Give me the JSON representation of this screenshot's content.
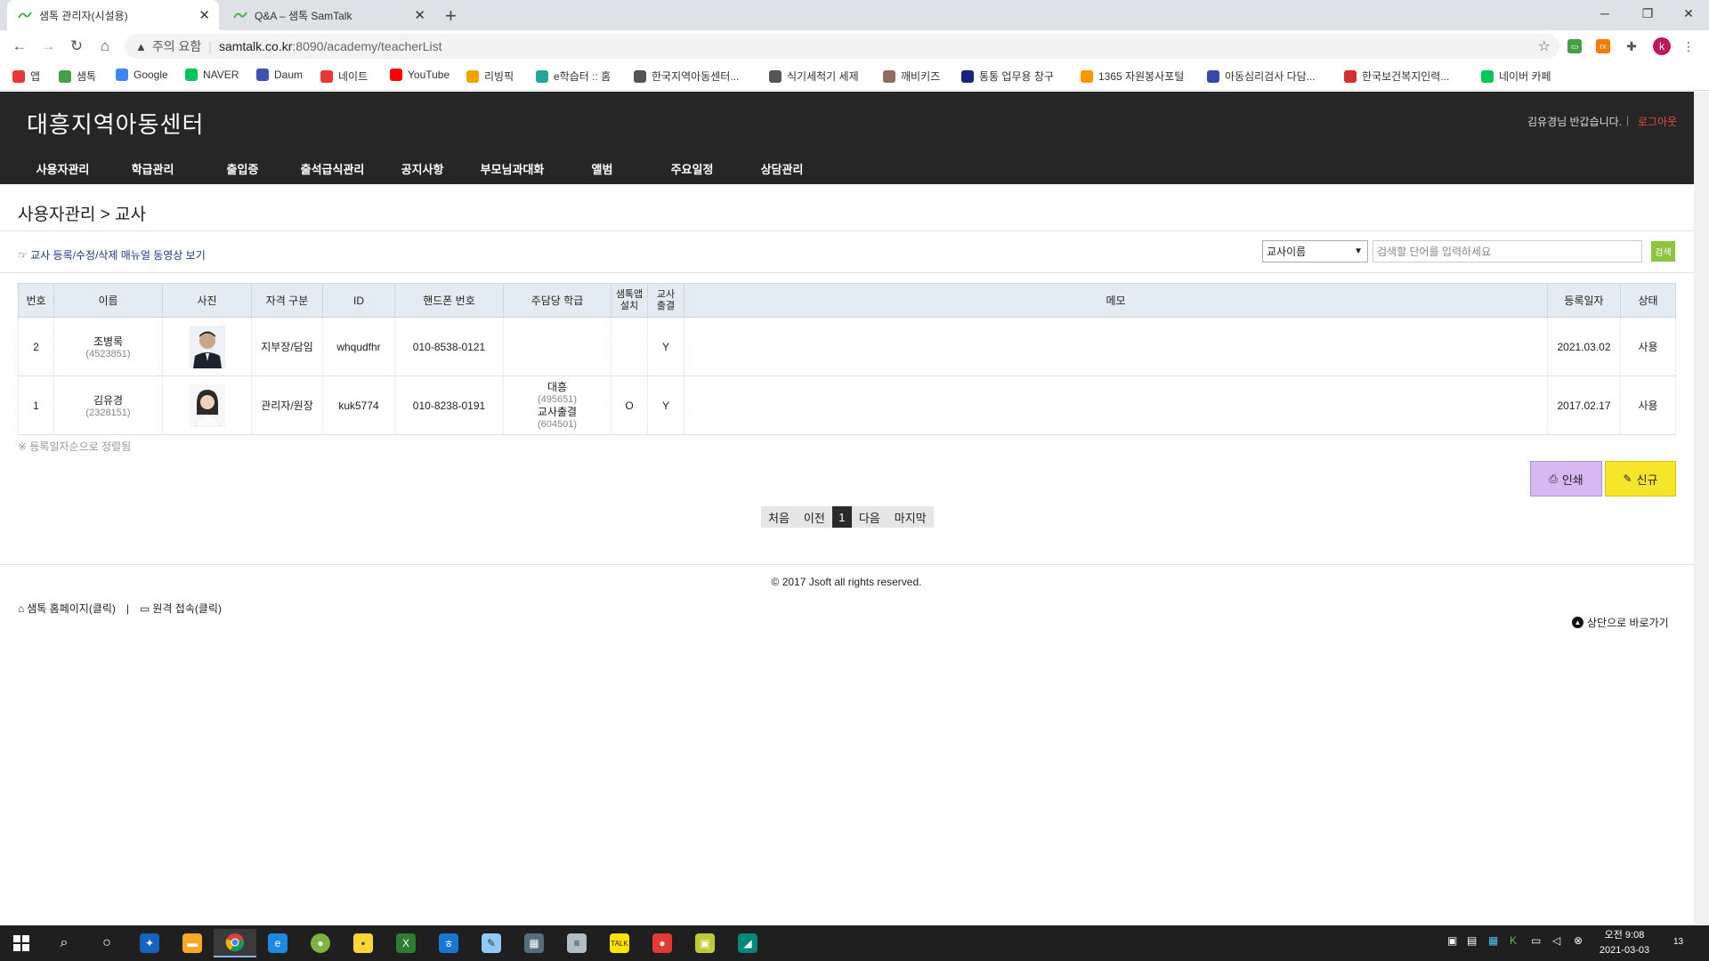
{
  "browser": {
    "tabs": [
      {
        "title": "샘톡 관리자(시설용)",
        "active": true
      },
      {
        "title": "Q&A – 샘톡 SamTalk",
        "active": false
      }
    ],
    "new_tab": "+",
    "window_controls": {
      "minimize": "─",
      "restore": "❐",
      "close": "✕"
    },
    "address": {
      "warning": "주의 요함",
      "host": "samtalk.co.kr",
      "path": ":8090/academy/teacherList"
    },
    "profile_initial": "k",
    "bookmarks": [
      {
        "label": "앱",
        "color": "#e53935"
      },
      {
        "label": "샘톡",
        "color": "#43a047"
      },
      {
        "label": "Google",
        "color": "#4285f4"
      },
      {
        "label": "NAVER",
        "color": "#03c75a"
      },
      {
        "label": "Daum",
        "color": "#3f51b5"
      },
      {
        "label": "네이트",
        "color": "#e53935"
      },
      {
        "label": "YouTube",
        "color": "#ff0000"
      },
      {
        "label": "리빙픽",
        "color": "#f4a300"
      },
      {
        "label": "e학습터 :: 홈",
        "color": "#26a69a"
      },
      {
        "label": "한국지역아동센터...",
        "color": "#555555"
      },
      {
        "label": "식기세척기 세제",
        "color": "#555555"
      },
      {
        "label": "깨비키즈",
        "color": "#8d6e63"
      },
      {
        "label": "통통 업무용 창구",
        "color": "#1a237e"
      },
      {
        "label": "1365 자원봉사포털",
        "color": "#ff9800"
      },
      {
        "label": "아동심리검사 다담...",
        "color": "#3949ab"
      },
      {
        "label": "한국보건복지인력...",
        "color": "#d32f2f"
      },
      {
        "label": "네이버 카페",
        "color": "#03c75a"
      }
    ]
  },
  "site": {
    "title": "대흥지역아동센터",
    "greeting": "김유경님 반갑습니다.",
    "separator": "|",
    "logout": "로그아웃",
    "nav": [
      "사용자관리",
      "학급관리",
      "출입증",
      "출석급식관리",
      "공지사항",
      "부모님과대화",
      "앨범",
      "주요일정",
      "상담관리"
    ]
  },
  "page": {
    "breadcrumb": "사용자관리 > 교사",
    "manual_link": "교사 등록/수정/삭제 매뉴얼 동영상 보기",
    "search": {
      "select_value": "교사이름",
      "placeholder": "검색할 단어를 입력하세요",
      "button": "검색"
    },
    "table": {
      "headers": {
        "no": "번호",
        "name": "이름",
        "photo": "사진",
        "qualification": "자격 구분",
        "id": "ID",
        "phone": "핸드폰 번호",
        "class": "주담당 학급",
        "app_line1": "샘톡앱",
        "app_line2": "설치",
        "attend_line1": "교사",
        "attend_line2": "출결",
        "memo": "메모",
        "date": "등록일자",
        "status": "상태"
      },
      "rows": [
        {
          "no": "2",
          "name": "조병록",
          "code": "(4523851)",
          "qualification": "지부장/담임",
          "id": "whqudfhr",
          "phone": "010-8538-0121",
          "class1": "",
          "class1_code": "",
          "class2": "",
          "class2_code": "",
          "app": "",
          "attend": "Y",
          "memo": "",
          "date": "2021.03.02",
          "status": "사용"
        },
        {
          "no": "1",
          "name": "김유경",
          "code": "(2328151)",
          "qualification": "관리자/원장",
          "id": "kuk5774",
          "phone": "010-8238-0191",
          "class1": "대흥",
          "class1_code": "(495651)",
          "class2": "교사출결",
          "class2_code": "(604501)",
          "app": "O",
          "attend": "Y",
          "memo": "",
          "date": "2017.02.17",
          "status": "사용"
        }
      ]
    },
    "note": "※ 등록일자순으로 정렬됨",
    "buttons": {
      "print": "인쇄",
      "new": "신규"
    },
    "pagination": {
      "first": "처음",
      "prev": "이전",
      "current": "1",
      "next": "다음",
      "last": "마지막"
    },
    "footer": {
      "copyright": "© 2017 Jsoft all rights reserved.",
      "homepage_link": "샘톡 홈페이지(클릭)",
      "separator": "|",
      "remote_link": "원격 접속(클릭)",
      "to_top": "상단으로 바로가기"
    }
  },
  "taskbar": {
    "clock_time": "오전 9:08",
    "clock_date": "2021-03-03",
    "notification_count": "13"
  }
}
